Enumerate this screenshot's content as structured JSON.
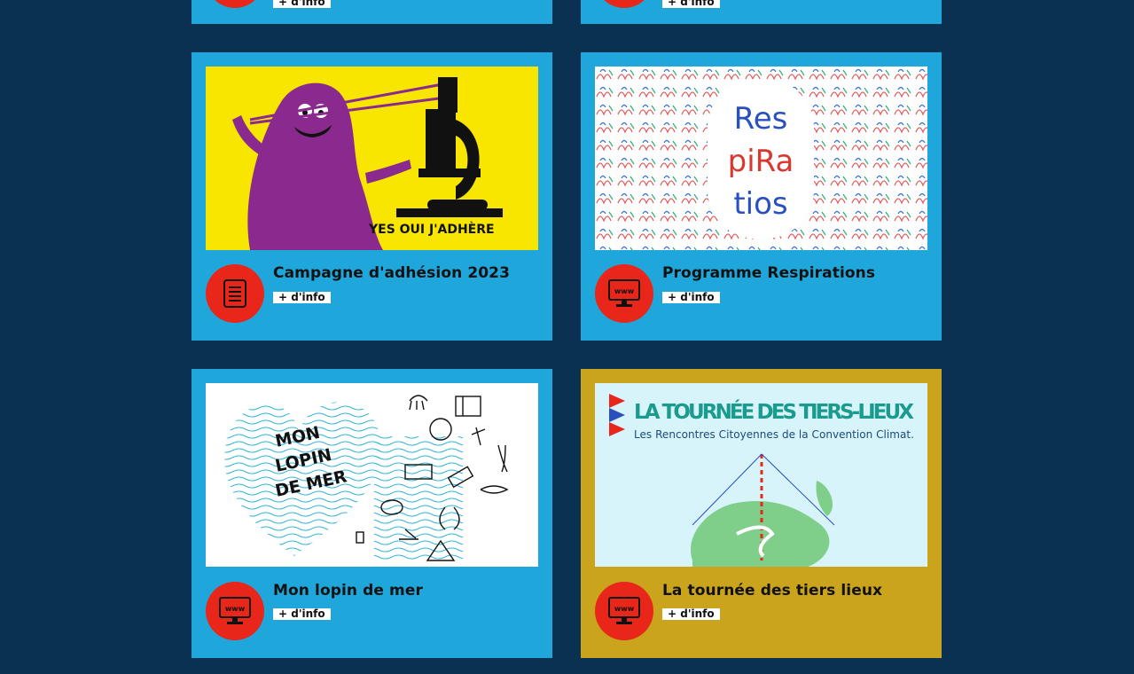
{
  "colors": {
    "page_bg": "#0a3151",
    "card_bg": "#1fa7dc",
    "card_bg_highlight": "#c9a41c",
    "icon_circle": "#e8261a"
  },
  "cards": [
    {
      "title": "",
      "info_label": "+ d'info",
      "icon": "document-icon"
    },
    {
      "title": "",
      "info_label": "+ d'info",
      "icon": "www-monitor-icon"
    },
    {
      "title": "Campagne d'adhésion 2023",
      "info_label": "+ d'info",
      "icon": "document-icon",
      "image_text": "YES OUI J'ADHÈRE"
    },
    {
      "title": "Programme Respirations",
      "info_label": "+ d'info",
      "icon": "www-monitor-icon",
      "image_text": [
        "Res",
        "piRa",
        "tios"
      ]
    },
    {
      "title": "Mon lopin de mer",
      "info_label": "+ d'info",
      "icon": "www-monitor-icon",
      "image_text": [
        "MON",
        "LOPIN",
        "DE MER"
      ]
    },
    {
      "title": "La tournée des tiers lieux",
      "info_label": "+ d'info",
      "icon": "www-monitor-icon",
      "image_text": [
        "LA TOURNÉE DES TIERS-LIEUX",
        "Les Rencontres Citoyennes de la Convention Climat."
      ]
    }
  ],
  "icon_text": "www"
}
